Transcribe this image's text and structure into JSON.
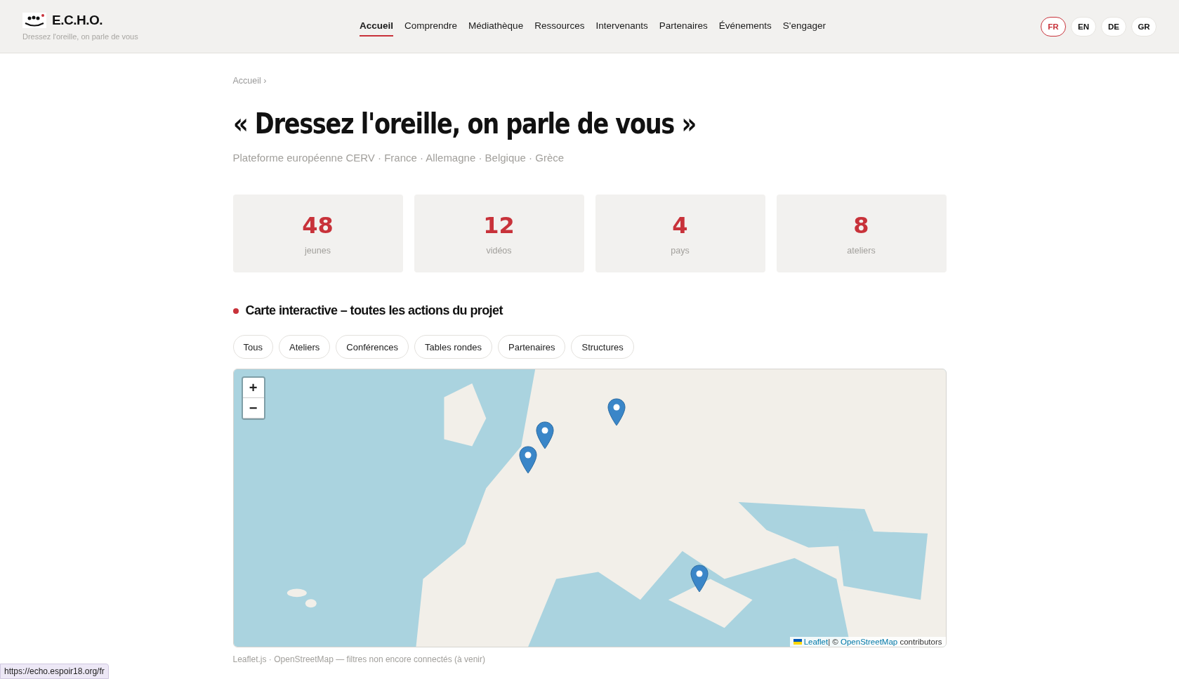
{
  "header": {
    "logo_title": "E.C.H.O.",
    "tagline": "Dressez l'oreille, on parle de vous",
    "nav": [
      {
        "label": "Accueil",
        "selected": true
      },
      {
        "label": "Comprendre",
        "selected": false
      },
      {
        "label": "Médiathèque",
        "selected": false
      },
      {
        "label": "Ressources",
        "selected": false
      },
      {
        "label": "Intervenants",
        "selected": false
      },
      {
        "label": "Partenaires",
        "selected": false
      },
      {
        "label": "Événements",
        "selected": false
      },
      {
        "label": "S'engager",
        "selected": false
      }
    ],
    "languages": [
      {
        "label": "FR",
        "selected": true
      },
      {
        "label": "EN",
        "selected": false
      },
      {
        "label": "DE",
        "selected": false
      },
      {
        "label": "GR",
        "selected": false
      }
    ]
  },
  "breadcrumb": "Accueil ›",
  "title": "« Dressez l'oreille, on parle de vous »",
  "subtitle": "Plateforme européenne CERV · France · Allemagne · Belgique · Grèce",
  "stats": [
    {
      "value": "48",
      "label": "jeunes"
    },
    {
      "value": "12",
      "label": "vidéos"
    },
    {
      "value": "4",
      "label": "pays"
    },
    {
      "value": "8",
      "label": "ateliers"
    }
  ],
  "section_title": "Carte interactive – toutes les actions du projet",
  "filters": [
    "Tous",
    "Ateliers",
    "Conférences",
    "Tables rondes",
    "Partenaires",
    "Structures"
  ],
  "map": {
    "kind": "picture",
    "zoom_in": "+",
    "zoom_out": "−",
    "attribution_leaflet": "Leaflet",
    "attribution_rest": "| © ",
    "attribution_osm": "OpenStreetMap",
    "attribution_suffix": " contributors"
  },
  "caption": "Leaflet.js · OpenStreetMap — filtres non encore connectés (à venir)",
  "status_url": "https://echo.espoir18.org/fr"
}
